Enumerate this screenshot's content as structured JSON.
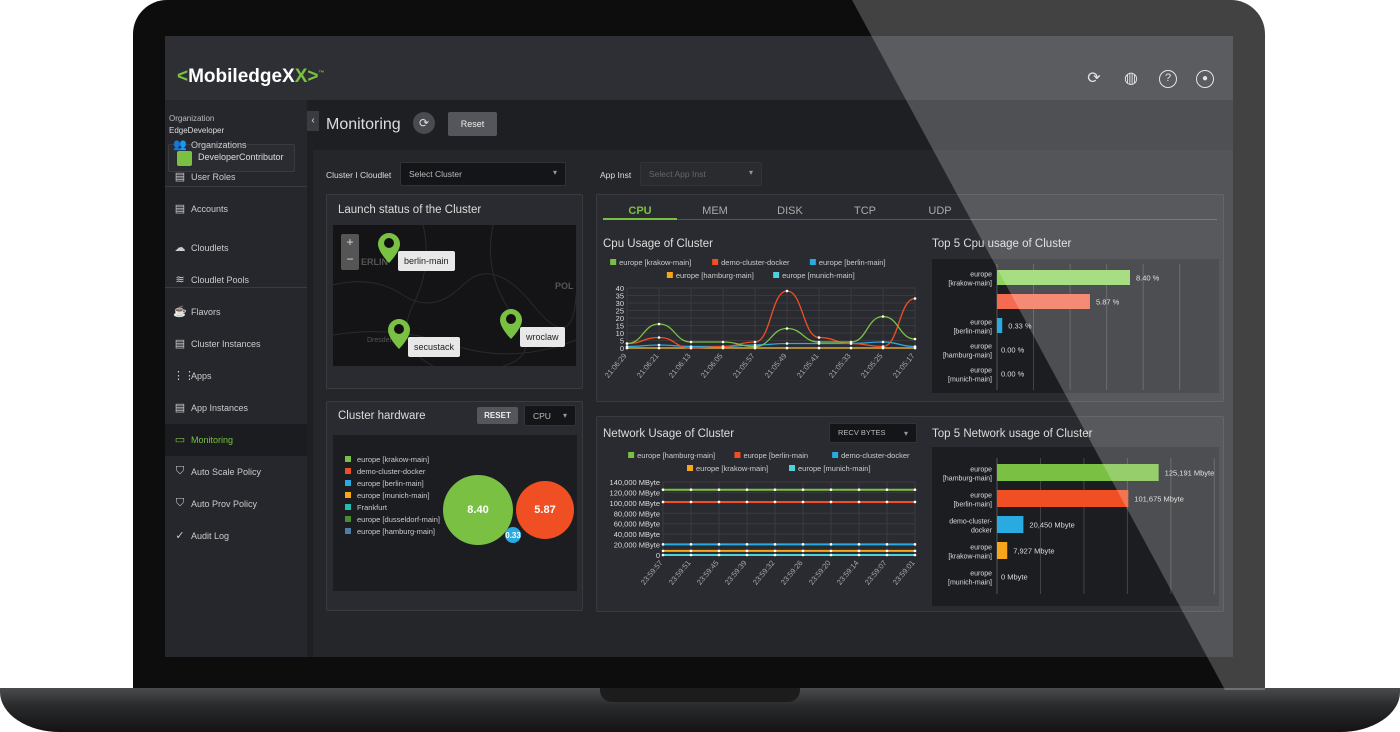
{
  "app": {
    "logo": "MobiledgeX",
    "logo_open": "<",
    "logo_close": "X>",
    "tm": "™"
  },
  "header_icons": [
    "refresh-icon",
    "globe-icon",
    "help-icon",
    "account-icon"
  ],
  "sidebar": {
    "org_label": "Organization",
    "org_name": "EdgeDeveloper",
    "role": "DeveloperContributor",
    "items": [
      {
        "label": "Organizations",
        "icon": "users-icon"
      },
      {
        "label": "User Roles",
        "icon": "list-icon"
      },
      {
        "label": "Accounts",
        "icon": "list-icon"
      },
      {
        "label": "Cloudlets",
        "icon": "cloud-icon"
      },
      {
        "label": "Cloudlet Pools",
        "icon": "pool-icon"
      },
      {
        "label": "Flavors",
        "icon": "cup-icon"
      },
      {
        "label": "Cluster Instances",
        "icon": "list-icon"
      },
      {
        "label": "Apps",
        "icon": "grid-icon"
      },
      {
        "label": "App Instances",
        "icon": "list-icon"
      },
      {
        "label": "Monitoring",
        "icon": "monitor-icon",
        "active": true
      },
      {
        "label": "Auto Scale Policy",
        "icon": "shield-icon"
      },
      {
        "label": "Auto Prov Policy",
        "icon": "shield-icon"
      },
      {
        "label": "Audit Log",
        "icon": "check-icon"
      }
    ]
  },
  "page": {
    "title": "Monitoring",
    "reset": "Reset",
    "collapse": "‹"
  },
  "filters": {
    "cluster_label": "Cluster I Cloudlet",
    "cluster_value": "Select Cluster",
    "app_label": "App Inst",
    "app_value": "Select App Inst"
  },
  "map": {
    "title": "Launch status of the Cluster",
    "zoom_in": "+",
    "zoom_out": "−",
    "labels": [
      "ERLIN",
      "POL",
      "Dresden"
    ],
    "pins": [
      "berlin-main",
      "secustack",
      "wroclaw"
    ]
  },
  "hardware": {
    "title": "Cluster hardware",
    "reset": "RESET",
    "metric": "CPU",
    "legend": [
      {
        "name": "europe [krakow-main]",
        "color": "#7ac143"
      },
      {
        "name": "demo-cluster-docker",
        "color": "#f04e23"
      },
      {
        "name": "europe [berlin-main]",
        "color": "#29aae1"
      },
      {
        "name": "europe [munich-main]",
        "color": "#f7a61b"
      },
      {
        "name": "Frankfurt",
        "color": "#1ebfae"
      },
      {
        "name": "europe [dusseldorf-main]",
        "color": "#4a8c2e"
      },
      {
        "name": "europe [hamburg-main]",
        "color": "#4c7fa8"
      }
    ],
    "bubbles": [
      {
        "label": "8.40",
        "value": 8.4,
        "color": "#7ac143"
      },
      {
        "label": "5.87",
        "value": 5.87,
        "color": "#f04e23"
      },
      {
        "label": "0.33",
        "value": 0.33,
        "color": "#29aae1"
      }
    ]
  },
  "tabs": [
    "CPU",
    "MEM",
    "DISK",
    "TCP",
    "UDP"
  ],
  "chart_data": [
    {
      "type": "line",
      "title": "Cpu Usage of Cluster",
      "ylim": [
        0,
        40
      ],
      "yticks": [
        0,
        5,
        10,
        15,
        20,
        25,
        30,
        35,
        40
      ],
      "x": [
        "21:06:29",
        "21:06:21",
        "21:06:13",
        "21:06:05",
        "21:05:57",
        "21:05:49",
        "21:05:41",
        "21:05:33",
        "21:05:25",
        "21:05:17"
      ],
      "series": [
        {
          "name": "europe [krakow-main]",
          "color": "#7ac143",
          "values": [
            3,
            16,
            4,
            4,
            1,
            13,
            4,
            4,
            21,
            6
          ]
        },
        {
          "name": "demo-cluster-docker",
          "color": "#f04e23",
          "values": [
            3,
            7,
            0,
            1,
            4,
            38,
            7,
            3,
            1,
            33
          ]
        },
        {
          "name": "europe [berlin-main]",
          "color": "#29aae1",
          "values": [
            1,
            2,
            1,
            1,
            2,
            3,
            3,
            3,
            4,
            1
          ]
        },
        {
          "name": "europe [hamburg-main]",
          "color": "#f7a61b",
          "values": [
            0,
            0,
            0,
            0,
            0,
            0,
            0,
            0,
            0,
            0
          ]
        },
        {
          "name": "europe [munich-main]",
          "color": "#4fd1d9",
          "values": [
            0,
            0,
            0,
            0,
            0,
            0,
            0,
            0,
            0,
            0
          ]
        }
      ]
    },
    {
      "type": "bar",
      "title": "Top 5 Cpu usage of Cluster",
      "categories": [
        "europe [krakow-main]",
        "",
        "europe [berlin-main]",
        "europe [hamburg-main]",
        "europe [munich-main]"
      ],
      "values": [
        8.4,
        5.87,
        0.33,
        0.0,
        0.0
      ],
      "labels": [
        "8.40 %",
        "5.87 %",
        "0.33 %",
        "0.00 %",
        "0.00 %"
      ],
      "colors": [
        "#8fd460",
        "#f46b4f",
        "#29aae1",
        "#f7a61b",
        "#4fd1d9"
      ],
      "xlim": [
        0,
        12
      ]
    },
    {
      "type": "line",
      "title": "Network Usage of Cluster",
      "metric": "RECV BYTES",
      "ylim": [
        0,
        140000
      ],
      "yticks": [
        "0",
        "20,000 MByte",
        "40,000 MByte",
        "60,000 MByte",
        "80,000 MByte",
        "100,000 MByte",
        "120,000 MByte",
        "140,000 MByte"
      ],
      "x": [
        "23:59:57",
        "23:59:51",
        "23:59:45",
        "23:59:39",
        "23:59:32",
        "23:59:26",
        "23:59:20",
        "23:59:14",
        "23:59:07",
        "23:59:01"
      ],
      "series": [
        {
          "name": "europe [hamburg-main]",
          "color": "#7ac143",
          "value": 125191
        },
        {
          "name": "europe [berlin-main",
          "color": "#f04e23",
          "value": 101675
        },
        {
          "name": "demo-cluster-docker",
          "color": "#29aae1",
          "value": 20450
        },
        {
          "name": "europe [krakow-main]",
          "color": "#f7a61b",
          "value": 7927
        },
        {
          "name": "europe [munich-main]",
          "color": "#4fd1d9",
          "value": 0
        }
      ]
    },
    {
      "type": "bar",
      "title": "Top 5 Network usage of Cluster",
      "categories": [
        "europe [hamburg-main]",
        "europe [berlin-main]",
        "demo-cluster- docker",
        "europe [krakow-main]",
        "europe [munich-main]"
      ],
      "values": [
        125191,
        101675,
        20450,
        7927,
        0
      ],
      "labels": [
        "125,191 Mbyte",
        "101,675 Mbyte",
        "20,450 Mbyte",
        "7,927 Mbyte",
        "0 Mbyte"
      ],
      "colors": [
        "#7ac143",
        "#f04e23",
        "#29aae1",
        "#f7a61b",
        "#4fd1d9"
      ],
      "xlim": [
        0,
        175000
      ]
    }
  ]
}
